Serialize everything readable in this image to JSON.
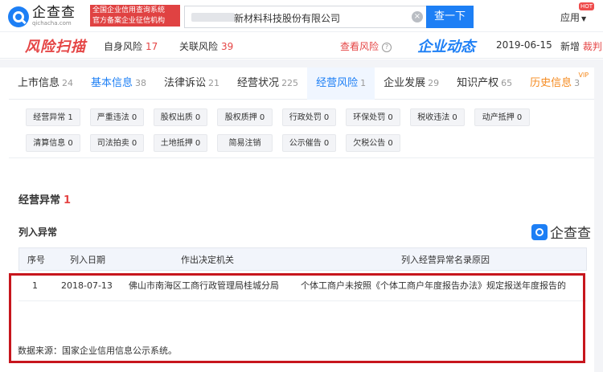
{
  "header": {
    "logo_cn": "企查查",
    "logo_en": "qichacha.com",
    "cert_line1": "全国企业信用查询系统",
    "cert_line2": "官方备案企业征信机构",
    "search_value": "新材料科技股份有限公司",
    "search_button": "查一下",
    "app_menu": "应用",
    "hot_badge": "HOT"
  },
  "risk_bar": {
    "title": "风险扫描",
    "self_risk_label": "自身风险",
    "self_risk_count": "17",
    "related_risk_label": "关联风险",
    "related_risk_count": "39",
    "view_risk": "查看风险",
    "dynamic_title": "企业动态",
    "dynamic_date": "2019-06-15",
    "dynamic_new": "新增",
    "dynamic_new_tail": "裁判"
  },
  "tabs": [
    {
      "label": "上市信息",
      "count": "24",
      "style": "plain"
    },
    {
      "label": "基本信息",
      "count": "38",
      "style": "blue"
    },
    {
      "label": "法律诉讼",
      "count": "21",
      "style": "plain"
    },
    {
      "label": "经营状况",
      "count": "225",
      "style": "plain"
    },
    {
      "label": "经营风险",
      "count": "1",
      "style": "active"
    },
    {
      "label": "企业发展",
      "count": "29",
      "style": "plain"
    },
    {
      "label": "知识产权",
      "count": "65",
      "style": "plain"
    },
    {
      "label": "历史信息",
      "count": "3",
      "style": "orange"
    }
  ],
  "vip_badge": "VIP",
  "filters": [
    "经营异常 1",
    "严重违法 0",
    "股权出质 0",
    "股权质押 0",
    "行政处罚 0",
    "环保处罚 0",
    "税收违法 0",
    "动产抵押 0",
    "清算信息 0",
    "司法拍卖 0",
    "土地抵押 0",
    "简易注销",
    "公示催告 0",
    "欠税公告 0"
  ],
  "section": {
    "title": "经营异常",
    "count": "1",
    "subtitle": "列入异常",
    "watermark": "企查查"
  },
  "table": {
    "headers": [
      "序号",
      "列入日期",
      "作出决定机关",
      "列入经营异常名录原因"
    ],
    "rows": [
      [
        "1",
        "2018-07-13",
        "佛山市南海区工商行政管理局桂城分局",
        "个体工商户未按照《个体工商户年度报告办法》规定报送年度报告的"
      ]
    ]
  },
  "source": "数据来源：国家企业信用信息公示系统。",
  "colors": {
    "brand_blue": "#1d7ff5",
    "risk_red": "#e54545",
    "highlight_red": "#c7161d"
  }
}
